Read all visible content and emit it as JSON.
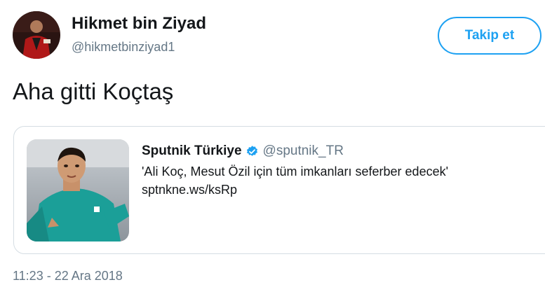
{
  "author": {
    "display_name": "Hikmet bin Ziyad",
    "handle": "@hikmetbinziyad1"
  },
  "follow_button": {
    "label": "Takip et"
  },
  "tweet": {
    "text": "Aha gitti Koçtaş",
    "timestamp": "11:23 - 22 Ara 2018"
  },
  "quoted_tweet": {
    "name": "Sputnik Türkiye",
    "verified_icon": "verified-badge-icon",
    "handle": "@sputnik_TR",
    "text": "'Ali Koç, Mesut Özil için tüm imkanları seferber edecek'",
    "link": "sptnkne.ws/ksRp"
  },
  "colors": {
    "accent": "#1da1f2",
    "secondary_text": "#657786",
    "border": "#d5dde3"
  }
}
